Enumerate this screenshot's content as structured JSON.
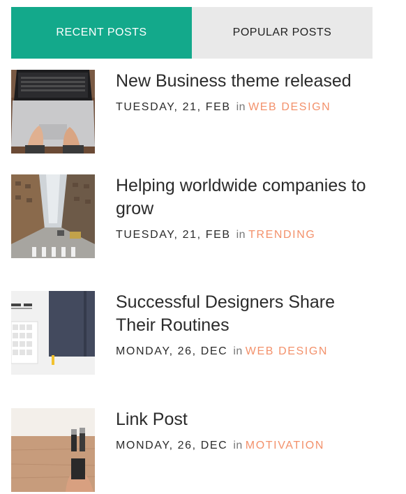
{
  "tabs": {
    "recent": "RECENT POSTS",
    "popular": "POPULAR POSTS"
  },
  "accent_color": "#13a98b",
  "category_color": "#f3916b",
  "in_label": "in",
  "posts": [
    {
      "title": "New Business theme released",
      "date": "TUESDAY, 21, FEB",
      "category": "WEB DESIGN",
      "thumb_icon": "laptop-photo"
    },
    {
      "title": "Helping worldwide companies to grow",
      "date": "TUESDAY, 21, FEB",
      "category": "TRENDING",
      "thumb_icon": "city-street-photo"
    },
    {
      "title": "Successful Designers Share Their Routines",
      "date": "MONDAY, 26, DEC",
      "category": "WEB DESIGN",
      "thumb_icon": "desk-keyboard-notebook-photo"
    },
    {
      "title": "Link Post",
      "date": "MONDAY, 26, DEC",
      "category": "MOTIVATION",
      "thumb_icon": "table-bottles-photo"
    }
  ]
}
